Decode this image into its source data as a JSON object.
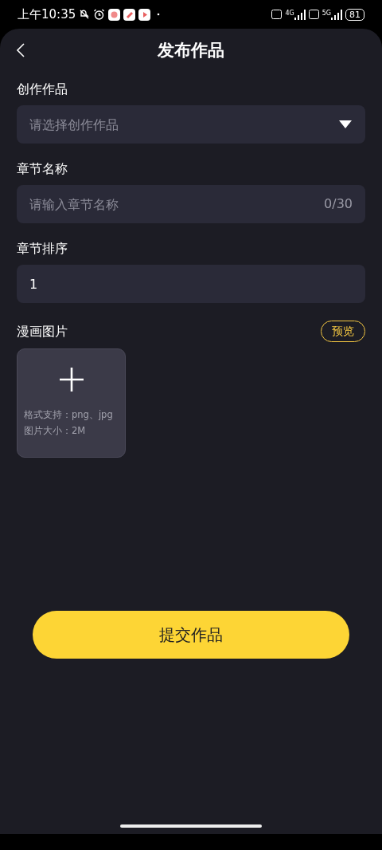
{
  "status_bar": {
    "time": "上午10:35",
    "network_1": "4G",
    "network_2": "5G",
    "battery": "81"
  },
  "header": {
    "title": "发布作品"
  },
  "fields": [
    {
      "kind": "select",
      "label": "创作作品",
      "placeholder": "请选择创作作品"
    },
    {
      "kind": "text",
      "label": "章节名称",
      "placeholder": "请输入章节名称",
      "counter": "0/30"
    },
    {
      "kind": "number",
      "label": "章节排序",
      "value": "1"
    }
  ],
  "images": {
    "label": "漫画图片",
    "preview_button": "预览",
    "upload_hints": [
      "格式支持：png、jpg",
      "图片大小：2M"
    ]
  },
  "submit_button": "提交作品"
}
